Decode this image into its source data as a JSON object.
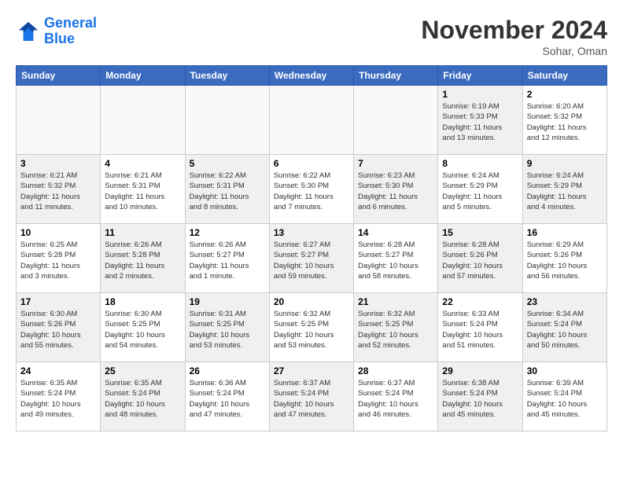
{
  "header": {
    "logo_line1": "General",
    "logo_line2": "Blue",
    "month": "November 2024",
    "location": "Sohar, Oman"
  },
  "weekdays": [
    "Sunday",
    "Monday",
    "Tuesday",
    "Wednesday",
    "Thursday",
    "Friday",
    "Saturday"
  ],
  "weeks": [
    [
      {
        "day": "",
        "info": "",
        "empty": true
      },
      {
        "day": "",
        "info": "",
        "empty": true
      },
      {
        "day": "",
        "info": "",
        "empty": true
      },
      {
        "day": "",
        "info": "",
        "empty": true
      },
      {
        "day": "",
        "info": "",
        "empty": true
      },
      {
        "day": "1",
        "info": "Sunrise: 6:19 AM\nSunset: 5:33 PM\nDaylight: 11 hours\nand 13 minutes.",
        "shaded": true
      },
      {
        "day": "2",
        "info": "Sunrise: 6:20 AM\nSunset: 5:32 PM\nDaylight: 11 hours\nand 12 minutes.",
        "shaded": false
      }
    ],
    [
      {
        "day": "3",
        "info": "Sunrise: 6:21 AM\nSunset: 5:32 PM\nDaylight: 11 hours\nand 11 minutes.",
        "shaded": true
      },
      {
        "day": "4",
        "info": "Sunrise: 6:21 AM\nSunset: 5:31 PM\nDaylight: 11 hours\nand 10 minutes.",
        "shaded": false
      },
      {
        "day": "5",
        "info": "Sunrise: 6:22 AM\nSunset: 5:31 PM\nDaylight: 11 hours\nand 8 minutes.",
        "shaded": true
      },
      {
        "day": "6",
        "info": "Sunrise: 6:22 AM\nSunset: 5:30 PM\nDaylight: 11 hours\nand 7 minutes.",
        "shaded": false
      },
      {
        "day": "7",
        "info": "Sunrise: 6:23 AM\nSunset: 5:30 PM\nDaylight: 11 hours\nand 6 minutes.",
        "shaded": true
      },
      {
        "day": "8",
        "info": "Sunrise: 6:24 AM\nSunset: 5:29 PM\nDaylight: 11 hours\nand 5 minutes.",
        "shaded": false
      },
      {
        "day": "9",
        "info": "Sunrise: 6:24 AM\nSunset: 5:29 PM\nDaylight: 11 hours\nand 4 minutes.",
        "shaded": true
      }
    ],
    [
      {
        "day": "10",
        "info": "Sunrise: 6:25 AM\nSunset: 5:28 PM\nDaylight: 11 hours\nand 3 minutes.",
        "shaded": false
      },
      {
        "day": "11",
        "info": "Sunrise: 6:26 AM\nSunset: 5:28 PM\nDaylight: 11 hours\nand 2 minutes.",
        "shaded": true
      },
      {
        "day": "12",
        "info": "Sunrise: 6:26 AM\nSunset: 5:27 PM\nDaylight: 11 hours\nand 1 minute.",
        "shaded": false
      },
      {
        "day": "13",
        "info": "Sunrise: 6:27 AM\nSunset: 5:27 PM\nDaylight: 10 hours\nand 59 minutes.",
        "shaded": true
      },
      {
        "day": "14",
        "info": "Sunrise: 6:28 AM\nSunset: 5:27 PM\nDaylight: 10 hours\nand 58 minutes.",
        "shaded": false
      },
      {
        "day": "15",
        "info": "Sunrise: 6:28 AM\nSunset: 5:26 PM\nDaylight: 10 hours\nand 57 minutes.",
        "shaded": true
      },
      {
        "day": "16",
        "info": "Sunrise: 6:29 AM\nSunset: 5:26 PM\nDaylight: 10 hours\nand 56 minutes.",
        "shaded": false
      }
    ],
    [
      {
        "day": "17",
        "info": "Sunrise: 6:30 AM\nSunset: 5:26 PM\nDaylight: 10 hours\nand 55 minutes.",
        "shaded": true
      },
      {
        "day": "18",
        "info": "Sunrise: 6:30 AM\nSunset: 5:25 PM\nDaylight: 10 hours\nand 54 minutes.",
        "shaded": false
      },
      {
        "day": "19",
        "info": "Sunrise: 6:31 AM\nSunset: 5:25 PM\nDaylight: 10 hours\nand 53 minutes.",
        "shaded": true
      },
      {
        "day": "20",
        "info": "Sunrise: 6:32 AM\nSunset: 5:25 PM\nDaylight: 10 hours\nand 53 minutes.",
        "shaded": false
      },
      {
        "day": "21",
        "info": "Sunrise: 6:32 AM\nSunset: 5:25 PM\nDaylight: 10 hours\nand 52 minutes.",
        "shaded": true
      },
      {
        "day": "22",
        "info": "Sunrise: 6:33 AM\nSunset: 5:24 PM\nDaylight: 10 hours\nand 51 minutes.",
        "shaded": false
      },
      {
        "day": "23",
        "info": "Sunrise: 6:34 AM\nSunset: 5:24 PM\nDaylight: 10 hours\nand 50 minutes.",
        "shaded": true
      }
    ],
    [
      {
        "day": "24",
        "info": "Sunrise: 6:35 AM\nSunset: 5:24 PM\nDaylight: 10 hours\nand 49 minutes.",
        "shaded": false
      },
      {
        "day": "25",
        "info": "Sunrise: 6:35 AM\nSunset: 5:24 PM\nDaylight: 10 hours\nand 48 minutes.",
        "shaded": true
      },
      {
        "day": "26",
        "info": "Sunrise: 6:36 AM\nSunset: 5:24 PM\nDaylight: 10 hours\nand 47 minutes.",
        "shaded": false
      },
      {
        "day": "27",
        "info": "Sunrise: 6:37 AM\nSunset: 5:24 PM\nDaylight: 10 hours\nand 47 minutes.",
        "shaded": true
      },
      {
        "day": "28",
        "info": "Sunrise: 6:37 AM\nSunset: 5:24 PM\nDaylight: 10 hours\nand 46 minutes.",
        "shaded": false
      },
      {
        "day": "29",
        "info": "Sunrise: 6:38 AM\nSunset: 5:24 PM\nDaylight: 10 hours\nand 45 minutes.",
        "shaded": true
      },
      {
        "day": "30",
        "info": "Sunrise: 6:39 AM\nSunset: 5:24 PM\nDaylight: 10 hours\nand 45 minutes.",
        "shaded": false
      }
    ]
  ]
}
